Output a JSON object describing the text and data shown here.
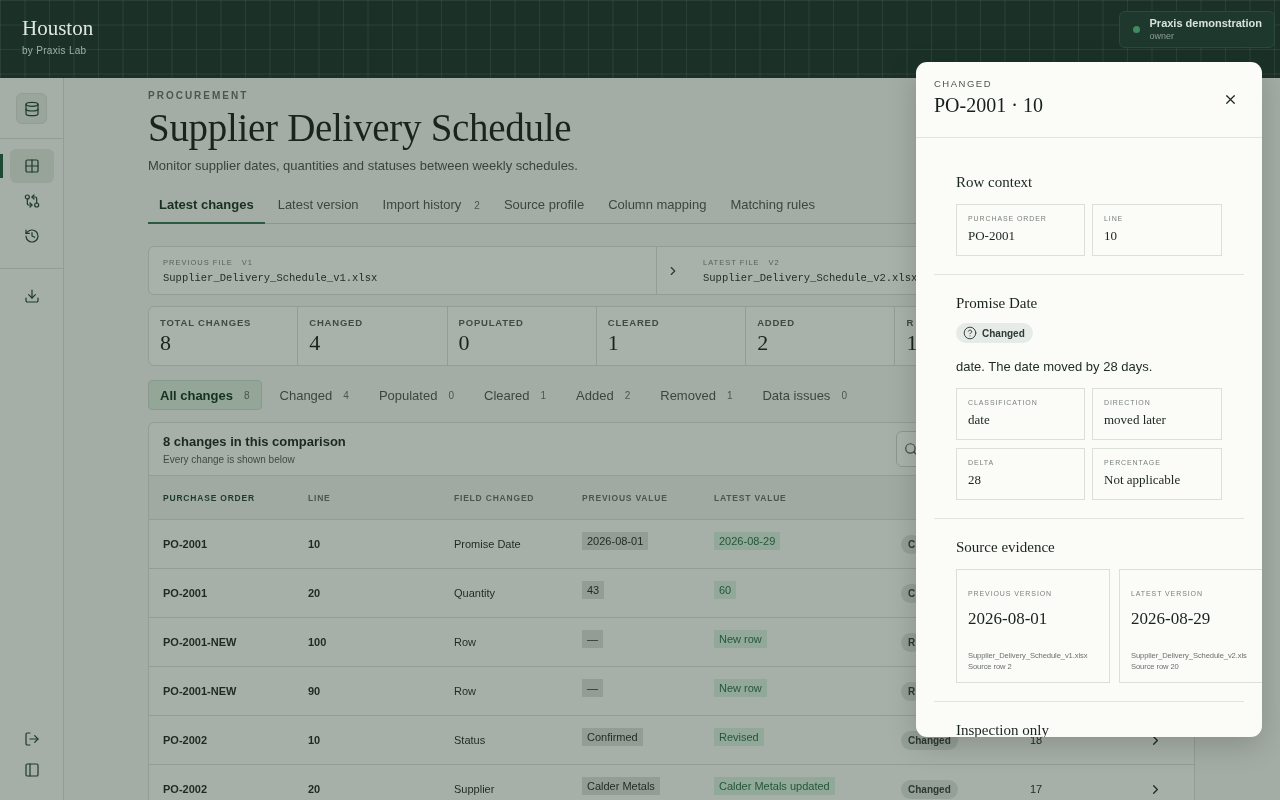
{
  "app": {
    "name": "Houston",
    "byline": "by Praxis Lab"
  },
  "account": {
    "name": "Praxis demonstration",
    "role": "owner"
  },
  "sidebar": {
    "items": [
      {
        "selected": true
      },
      {
        "selected": false
      },
      {
        "selected": false
      },
      {
        "selected": false
      }
    ]
  },
  "page": {
    "eyebrow": "PROCUREMENT",
    "title": "Supplier Delivery Schedule",
    "subtitle": "Monitor supplier dates, quantities and statuses between weekly schedules."
  },
  "tabs": [
    {
      "label": "Latest changes",
      "selected": true
    },
    {
      "label": "Latest version",
      "selected": false
    },
    {
      "label": "Import history",
      "count": "2",
      "selected": false
    },
    {
      "label": "Source profile",
      "selected": false
    },
    {
      "label": "Column mapping",
      "selected": false
    },
    {
      "label": "Matching rules",
      "selected": false
    }
  ],
  "files": {
    "previous": {
      "label": "PREVIOUS FILE",
      "version": "V1",
      "name": "Supplier_Delivery_Schedule_v1.xlsx"
    },
    "latest": {
      "label": "LATEST FILE",
      "version": "V2",
      "name": "Supplier_Delivery_Schedule_v2.xlsx"
    }
  },
  "stats": [
    {
      "label": "TOTAL CHANGES",
      "value": "8"
    },
    {
      "label": "CHANGED",
      "value": "4"
    },
    {
      "label": "POPULATED",
      "value": "0"
    },
    {
      "label": "CLEARED",
      "value": "1"
    },
    {
      "label": "ADDED",
      "value": "2"
    },
    {
      "label": "R",
      "value": "1"
    }
  ],
  "filters": [
    {
      "label": "All changes",
      "count": "8",
      "selected": true
    },
    {
      "label": "Changed",
      "count": "4",
      "selected": false
    },
    {
      "label": "Populated",
      "count": "0",
      "selected": false
    },
    {
      "label": "Cleared",
      "count": "1",
      "selected": false
    },
    {
      "label": "Added",
      "count": "2",
      "selected": false
    },
    {
      "label": "Removed",
      "count": "1",
      "selected": false
    },
    {
      "label": "Data issues",
      "count": "0",
      "selected": false
    }
  ],
  "table": {
    "title": "8 changes in this comparison",
    "subtitle": "Every change is shown below",
    "columns": [
      "PURCHASE ORDER",
      "LINE",
      "FIELD CHANGED",
      "PREVIOUS VALUE",
      "LATEST VALUE"
    ],
    "rows": [
      {
        "purchase_order": "PO-2001",
        "line": "10",
        "field": "Promise Date",
        "previous": "2026-08-01",
        "latest": "2026-08-29",
        "change": "C"
      },
      {
        "purchase_order": "PO-2001",
        "line": "20",
        "field": "Quantity",
        "previous": "43",
        "latest": "60",
        "change": "C"
      },
      {
        "purchase_order": "PO-2001-NEW",
        "line": "100",
        "field": "Row",
        "previous": "—",
        "latest": "New row",
        "change": "R"
      },
      {
        "purchase_order": "PO-2001-NEW",
        "line": "90",
        "field": "Row",
        "previous": "—",
        "latest": "New row",
        "change": "R"
      },
      {
        "purchase_order": "PO-2002",
        "line": "10",
        "field": "Status",
        "previous": "Confirmed",
        "latest": "Revised",
        "change": "Changed",
        "column_7": "18"
      },
      {
        "purchase_order": "PO-2002",
        "line": "20",
        "field": "Supplier",
        "previous": "Calder Metals",
        "latest": "Calder Metals updated",
        "change": "Changed",
        "column_7": "17"
      }
    ]
  },
  "drawer": {
    "eyebrow": "CHANGED",
    "title": "PO-2001 · 10",
    "row_context": {
      "heading": "Row context",
      "fields": [
        {
          "label": "PURCHASE ORDER",
          "value": "PO-2001"
        },
        {
          "label": "LINE",
          "value": "10"
        }
      ]
    },
    "field_section": {
      "heading": "Promise Date",
      "status": "Changed",
      "note": "date. The date moved by 28 days.",
      "fields": [
        {
          "label": "CLASSIFICATION",
          "value": "date"
        },
        {
          "label": "DIRECTION",
          "value": "moved later"
        },
        {
          "label": "DELTA",
          "value": "28"
        },
        {
          "label": "PERCENTAGE",
          "value": "Not applicable"
        }
      ]
    },
    "evidence": {
      "heading": "Source evidence",
      "cards": [
        {
          "label": "PREVIOUS VERSION",
          "value": "2026-08-01",
          "file": "Supplier_Delivery_Schedule_v1.xlsx",
          "row": "Source row 2"
        },
        {
          "label": "LATEST VERSION",
          "value": "2026-08-29",
          "file": "Supplier_Delivery_Schedule_v2.xls",
          "row": "Source row 20"
        }
      ]
    },
    "next_heading": "Inspection only"
  }
}
